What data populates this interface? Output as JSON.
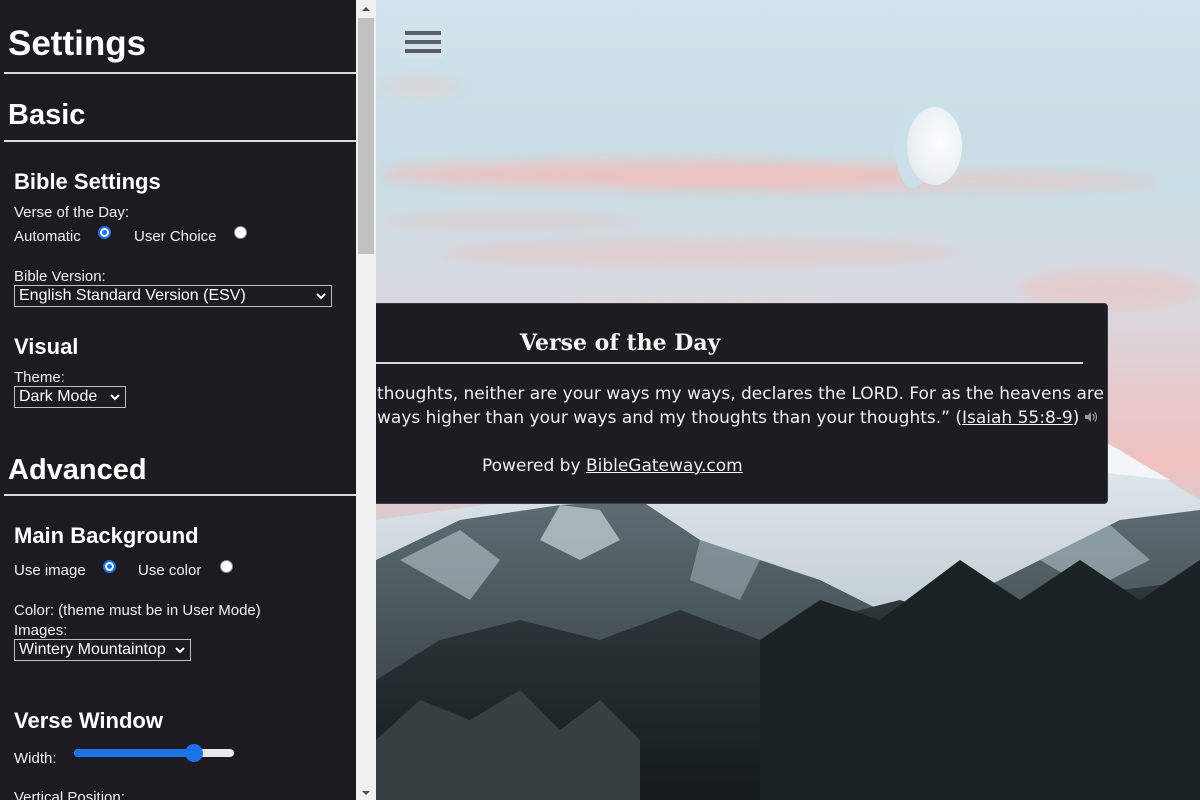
{
  "settings": {
    "title": "Settings",
    "basic_heading": "Basic",
    "bible_settings_heading": "Bible Settings",
    "verse_of_day_label": "Verse of the Day:",
    "automatic_label": "Automatic",
    "user_choice_label": "User Choice",
    "verse_mode_selected": "Automatic",
    "bible_version_label": "Bible Version:",
    "bible_version_value": "English Standard Version (ESV)",
    "visual_heading": "Visual",
    "theme_label": "Theme:",
    "theme_value": "Dark Mode",
    "advanced_heading": "Advanced",
    "main_background_heading": "Main Background",
    "use_image_label": "Use image",
    "use_color_label": "Use color",
    "background_mode_selected": "Use image",
    "color_label": "Color: (theme must be in User Mode)",
    "images_label": "Images:",
    "images_value": "Wintery Mountaintop",
    "verse_window_heading": "Verse Window",
    "width_label": "Width:",
    "width_slider_fraction": 0.78,
    "vertical_position_label": "Vertical Position:"
  },
  "verse_card": {
    "title": "Verse of the Day",
    "line1": "thoughts, neither are your ways my ways, declares the LORD. For as the heavens are higher",
    "line2_prefix": "ways higher than your ways and my thoughts than your thoughts.” (",
    "reference": "Isaiah 55:8-9",
    "line2_suffix": ")",
    "powered_prefix": "Powered by ",
    "powered_link": "BibleGateway.com"
  },
  "scrollbar": {
    "thumb_fraction": 0.3
  },
  "colors": {
    "sidebar_bg": "#1c1b21",
    "accent": "#1a73e8",
    "card_bg": "#1d1c22"
  },
  "icons": {
    "menu": "hamburger-menu-icon",
    "audio": "speaker-icon",
    "dropdown": "chevron-down-icon"
  }
}
